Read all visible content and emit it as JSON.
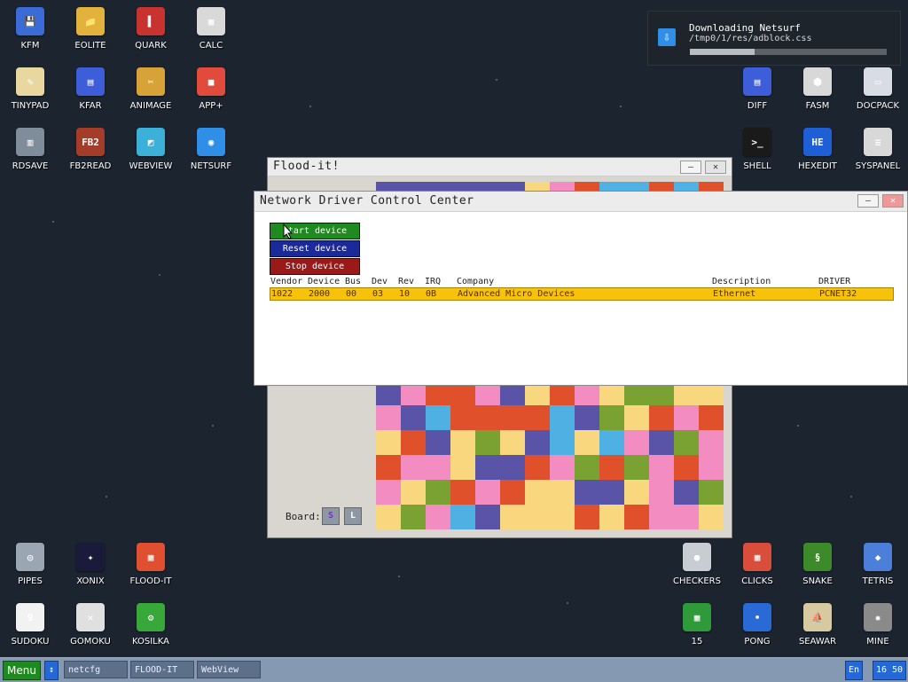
{
  "desktop_icons": [
    {
      "label": "KFM",
      "icon": "floppy-icon",
      "color": "#3a6bd6"
    },
    {
      "label": "EOLITE",
      "icon": "folder-icon",
      "color": "#e3b23c"
    },
    {
      "label": "QUARK",
      "icon": "notebook-icon",
      "color": "#c8322f"
    },
    {
      "label": "CALC",
      "icon": "calculator-icon",
      "color": "#d9d9d9"
    },
    {
      "label": "TINYPAD",
      "icon": "notepad-icon",
      "color": "#e8d8a0"
    },
    {
      "label": "KFAR",
      "icon": "archive-icon",
      "color": "#3d5ed8"
    },
    {
      "label": "ANIMAGE",
      "icon": "brush-icon",
      "color": "#d7a338"
    },
    {
      "label": "APP+",
      "icon": "cube-icon",
      "color": "#e04b3c"
    },
    {
      "label": "RDSAVE",
      "icon": "save-icon",
      "color": "#7f8c99"
    },
    {
      "label": "FB2READ",
      "icon": "book-icon",
      "color": "#a33d2a"
    },
    {
      "label": "WEBVIEW",
      "icon": "webview-icon",
      "color": "#3bb0d8"
    },
    {
      "label": "NETSURF",
      "icon": "globe-icon",
      "color": "#2f8fe6"
    },
    {
      "label": "DIFF",
      "icon": "diff-icon",
      "color": "#3d5ed8"
    },
    {
      "label": "FASM",
      "icon": "fasm-icon",
      "color": "#d8d8d8"
    },
    {
      "label": "DOCPACK",
      "icon": "cabinet-icon",
      "color": "#d8dce4"
    },
    {
      "label": "SHELL",
      "icon": "terminal-icon",
      "color": "#1a1a1a"
    },
    {
      "label": "HEXEDIT",
      "icon": "hex-icon",
      "color": "#1e5fd6"
    },
    {
      "label": "SYSPANEL",
      "icon": "sliders-icon",
      "color": "#d8d8d8"
    },
    {
      "label": "PIPES",
      "icon": "pipes-icon",
      "color": "#9aa7b3"
    },
    {
      "label": "XONIX",
      "icon": "xonix-icon",
      "color": "#1a1a3a"
    },
    {
      "label": "FLOOD-IT",
      "icon": "flood-icon",
      "color": "#e05030"
    },
    {
      "label": "SUDOKU",
      "icon": "sudoku-icon",
      "color": "#f2f2f2"
    },
    {
      "label": "GOMOKU",
      "icon": "gomoku-icon",
      "color": "#e0e0e0"
    },
    {
      "label": "KOSILKA",
      "icon": "mower-icon",
      "color": "#39a83a"
    },
    {
      "label": "CHECKERS",
      "icon": "checkers-icon",
      "color": "#c8cdd4"
    },
    {
      "label": "CLICKS",
      "icon": "clicks-icon",
      "color": "#d94d3b"
    },
    {
      "label": "SNAKE",
      "icon": "snake-icon",
      "color": "#3d8a2a"
    },
    {
      "label": "TETRIS",
      "icon": "tetris-icon",
      "color": "#4c7fd9"
    },
    {
      "label": "15",
      "icon": "fifteen-icon",
      "color": "#2e9a3a"
    },
    {
      "label": "PONG",
      "icon": "pong-icon",
      "color": "#2a6ad6"
    },
    {
      "label": "SEAWAR",
      "icon": "ship-icon",
      "color": "#d9c9a0"
    },
    {
      "label": "MINE",
      "icon": "mine-icon",
      "color": "#8a8a8a"
    }
  ],
  "notification": {
    "title": "Downloading Netsurf",
    "path": "/tmp0/1/res/adblock.css",
    "progress": 0.33,
    "icon": "download-icon"
  },
  "flood_window": {
    "title": "Flood-it!",
    "board_label": "Board:",
    "btn_s": "S",
    "btn_l": "L",
    "minimize": "–",
    "close": "✕",
    "palette": [
      "#5a54a8",
      "#f28cc1",
      "#e0502a",
      "#f8d77e",
      "#7aa232",
      "#4fb0e4"
    ],
    "grid": [
      [
        0,
        0,
        0,
        0,
        0,
        0,
        3,
        1,
        2,
        5,
        5,
        2,
        5,
        2
      ],
      [
        0,
        0,
        0,
        0,
        0,
        0,
        3,
        1,
        2,
        5,
        5,
        2,
        5,
        2
      ],
      [
        0,
        0,
        0,
        0,
        0,
        0,
        3,
        1,
        2,
        5,
        5,
        2,
        5,
        2
      ],
      [
        0,
        0,
        0,
        0,
        0,
        0,
        3,
        1,
        2,
        5,
        5,
        2,
        5,
        2
      ],
      [
        0,
        0,
        0,
        0,
        0,
        0,
        3,
        1,
        2,
        5,
        5,
        2,
        5,
        2
      ],
      [
        0,
        0,
        0,
        0,
        0,
        0,
        3,
        1,
        2,
        5,
        5,
        2,
        5,
        2
      ],
      [
        0,
        0,
        0,
        0,
        0,
        0,
        3,
        1,
        2,
        5,
        5,
        2,
        5,
        2
      ],
      [
        0,
        0,
        0,
        0,
        0,
        0,
        3,
        1,
        2,
        5,
        5,
        2,
        5,
        2
      ],
      [
        0,
        1,
        2,
        2,
        1,
        0,
        3,
        2,
        1,
        3,
        4,
        4,
        3,
        3
      ],
      [
        1,
        0,
        5,
        2,
        2,
        2,
        2,
        5,
        0,
        4,
        3,
        2,
        1,
        2
      ],
      [
        3,
        2,
        0,
        3,
        4,
        3,
        0,
        5,
        3,
        5,
        1,
        0,
        4,
        1
      ],
      [
        2,
        1,
        1,
        3,
        0,
        0,
        2,
        1,
        4,
        2,
        4,
        1,
        2,
        1
      ],
      [
        1,
        3,
        4,
        2,
        1,
        2,
        3,
        3,
        0,
        0,
        3,
        1,
        0,
        4
      ],
      [
        3,
        4,
        1,
        5,
        0,
        3,
        3,
        3,
        2,
        3,
        2,
        1,
        1,
        3
      ]
    ]
  },
  "ndcc_window": {
    "title": "Network Driver Control Center",
    "start_button": "Start device",
    "reset_button": "Reset device",
    "stop_button": "Stop device",
    "minimize": "–",
    "close": "✕",
    "columns": [
      "Vendor",
      "Device",
      "Bus",
      "Dev",
      "Rev",
      "IRQ",
      "Company",
      "Description",
      "DRIVER"
    ],
    "rows": [
      {
        "vendor": "1022",
        "device": "2000",
        "bus": "00",
        "dev": "03",
        "rev": "10",
        "irq": "0B",
        "company": "Advanced Micro Devices",
        "description": "Ethernet",
        "driver": "PCNET32"
      }
    ]
  },
  "taskbar": {
    "menu_label": "Menu",
    "arrow": "↕",
    "tasks": [
      "netcfg",
      "FLOOD-IT",
      "WebView"
    ],
    "language": "En",
    "clock": "16 50"
  }
}
